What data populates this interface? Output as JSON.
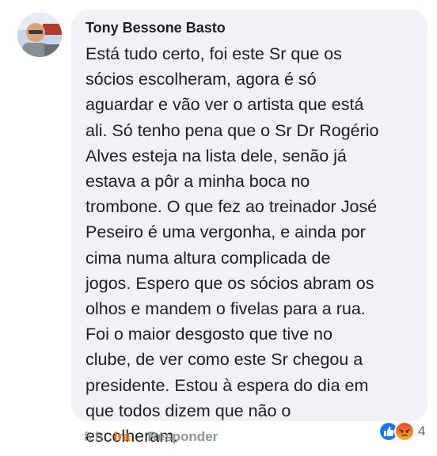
{
  "comment": {
    "author": "Tony Bessone Basto",
    "lines": [
      "Está tudo certo, foi este Sr que os",
      "sócios escolheram, agora é só",
      "aguardar e vão ver o artista que está",
      "ali. Só tenho pena que o Sr Dr Rogério",
      "Alves esteja na lista dele, senão já",
      "estava a pôr a minha boca no",
      "trombone. O que fez ao treinador José",
      "Peseiro é uma vergonha, e ainda por",
      "cima numa altura complicada de",
      "jogos. Espero que os sócios abram os",
      "olhos e mandem o fivelas para a rua.",
      "Foi o maior desgosto que tive no",
      "clube, de ver como este Sr chegou a",
      "presidente. Estou à espera do dia em",
      "que todos dizem que não o",
      "escolheram."
    ]
  },
  "actions": {
    "time": "8 h",
    "reaction_label": "Ira",
    "reply_label": "Responder"
  },
  "reactions": {
    "icons": [
      "like-icon",
      "angry-icon"
    ],
    "count": "4"
  },
  "colors": {
    "bubble": "#f1f2f6",
    "text": "#1c1e21",
    "muted": "#8d949e",
    "ira": "#e9710f",
    "like": "#1877f2",
    "angry": "#f0803c"
  }
}
